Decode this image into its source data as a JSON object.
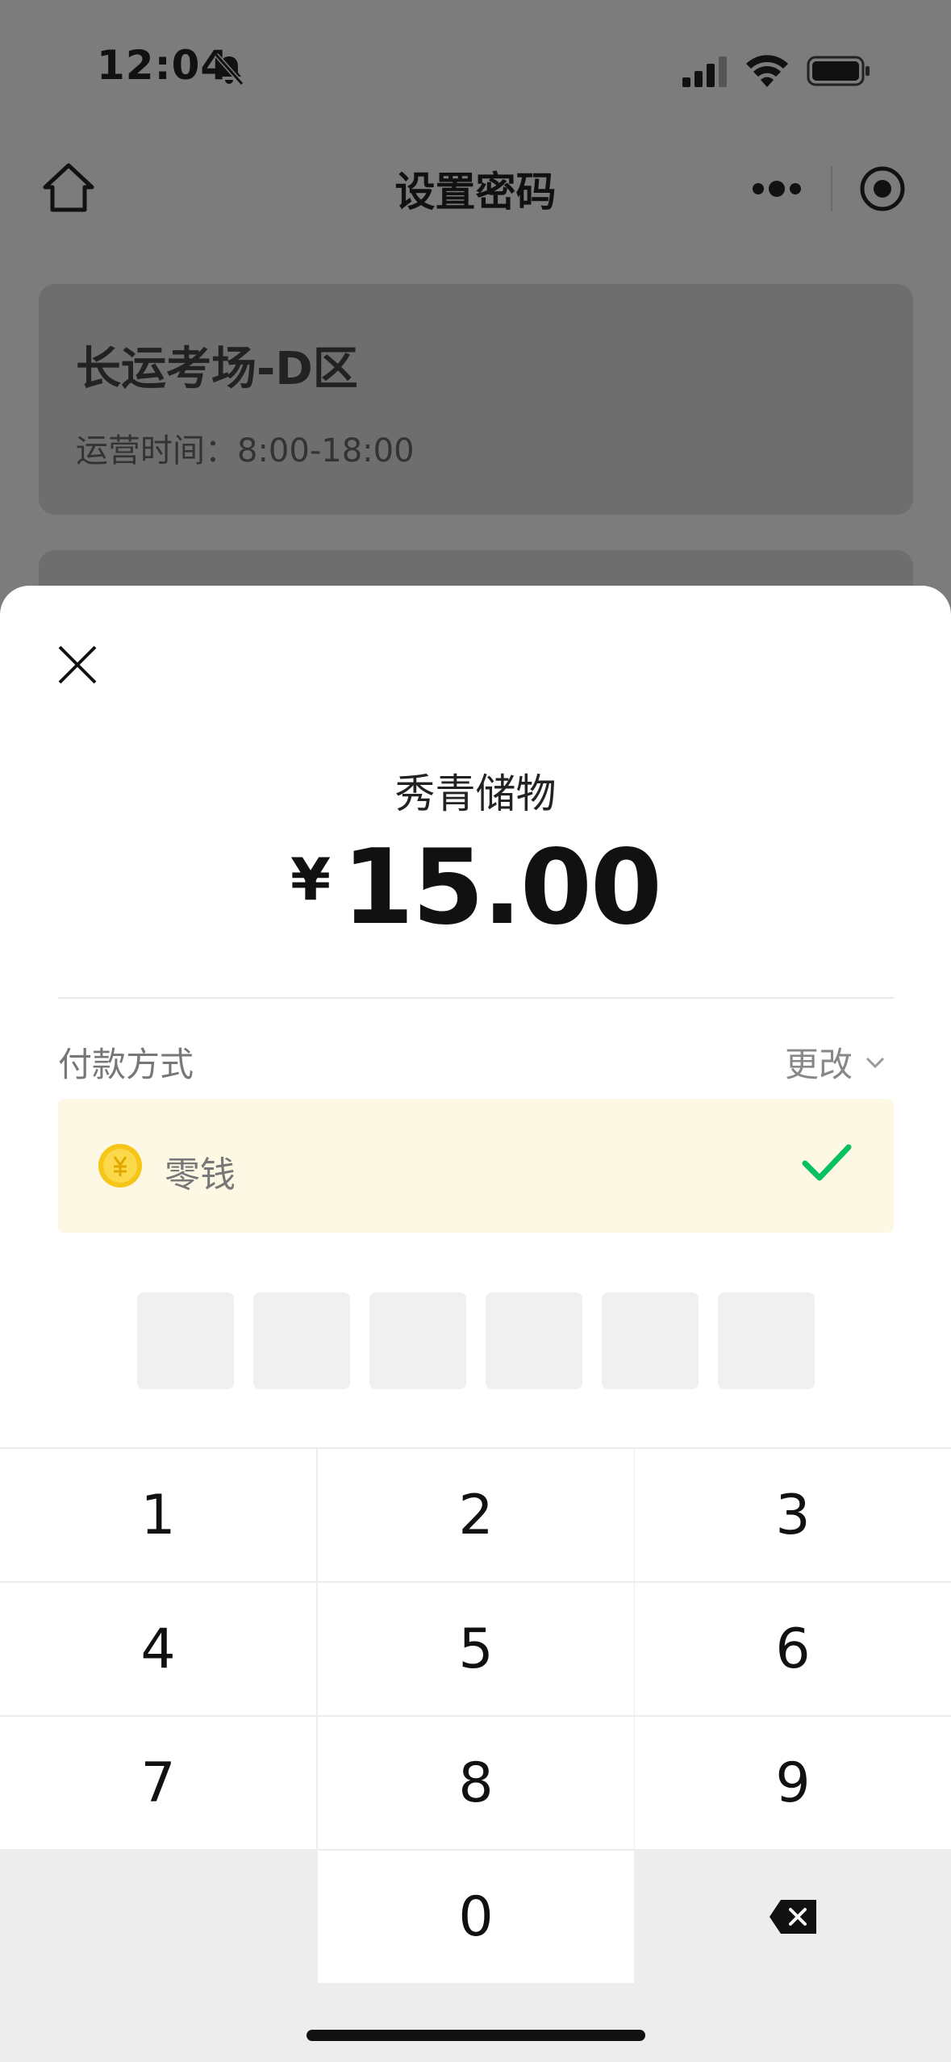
{
  "status": {
    "time": "12:04"
  },
  "nav": {
    "title": "设置密码"
  },
  "info_card": {
    "title": "长运考场-D区",
    "hours": "运营时间：8:00-18:00"
  },
  "payment": {
    "merchant": "秀青储物",
    "currency": "¥",
    "amount": "15.00",
    "method_label": "付款方式",
    "change_label": "更改",
    "method_name": "零钱",
    "pin_length": 6
  },
  "keypad": {
    "keys": [
      "1",
      "2",
      "3",
      "4",
      "5",
      "6",
      "7",
      "8",
      "9",
      "0"
    ]
  },
  "colors": {
    "accent_check": "#07c160",
    "coin": "#f5c518",
    "method_bg": "#fdf8e4"
  },
  "icons": [
    "home-icon",
    "more-icon",
    "target-icon",
    "close-icon",
    "coin-icon",
    "check-icon",
    "backspace-icon",
    "chevron-down-icon"
  ]
}
